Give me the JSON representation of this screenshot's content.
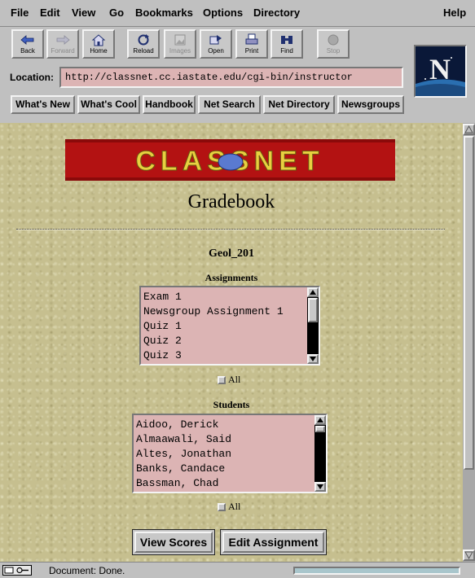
{
  "menu": {
    "items": [
      "File",
      "Edit",
      "View",
      "Go",
      "Bookmarks",
      "Options",
      "Directory"
    ],
    "help": "Help"
  },
  "toolbar": {
    "buttons": [
      {
        "label": "Back",
        "icon": "back-arrow-icon",
        "enabled": true
      },
      {
        "label": "Forward",
        "icon": "forward-arrow-icon",
        "enabled": false
      },
      {
        "label": "Home",
        "icon": "home-icon",
        "enabled": true
      },
      {
        "label": "Reload",
        "icon": "reload-icon",
        "enabled": true
      },
      {
        "label": "Images",
        "icon": "images-icon",
        "enabled": false
      },
      {
        "label": "Open",
        "icon": "open-icon",
        "enabled": true
      },
      {
        "label": "Print",
        "icon": "print-icon",
        "enabled": true
      },
      {
        "label": "Find",
        "icon": "find-icon",
        "enabled": true
      },
      {
        "label": "Stop",
        "icon": "stop-icon",
        "enabled": false
      }
    ],
    "location_label": "Location:",
    "location_value": "http://classnet.cc.iastate.edu/cgi-bin/instructor",
    "directory_buttons": [
      "What's New",
      "What's Cool",
      "Handbook",
      "Net Search",
      "Net Directory",
      "Newsgroups"
    ],
    "logo_letter": "N"
  },
  "page": {
    "banner_text": "CLASSNET",
    "title": "Gradebook",
    "course": "Geol_201",
    "assignments_heading": "Assignments",
    "assignments": [
      "Exam 1",
      "Newsgroup Assignment 1",
      "Quiz 1",
      "Quiz 2",
      "Quiz 3"
    ],
    "assignments_all_label": "All",
    "students_heading": "Students",
    "students": [
      "Aidoo, Derick",
      "Almaawali, Said",
      "Altes, Jonathan",
      "Banks, Candace",
      "Bassman, Chad"
    ],
    "students_all_label": "All",
    "view_scores_label": "View Scores",
    "edit_assignment_label": "Edit Assignment"
  },
  "status": {
    "text": "Document: Done."
  },
  "colors": {
    "background_texture": "#c6bf8f",
    "listbox_bg": "#dcb4b4",
    "banner_red": "#b01010",
    "chrome_grey": "#c0c0c0"
  }
}
